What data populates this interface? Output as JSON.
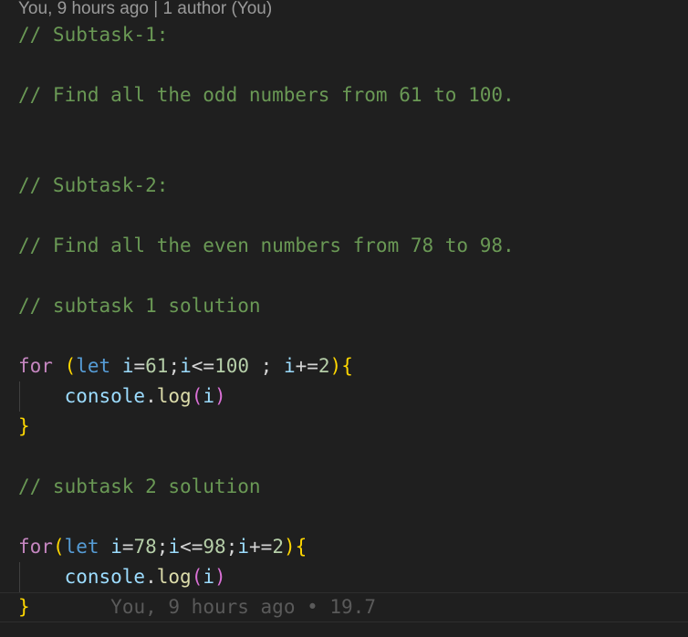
{
  "codelens": {
    "text": "You, 9 hours ago | 1 author (You)"
  },
  "comments": {
    "subtask1": "// Subtask-1:",
    "subtask1_desc": "// Find all the odd numbers from 61 to 100.",
    "subtask2": "// Subtask-2:",
    "subtask2_desc": "// Find all the even numbers from 78 to 98.",
    "solution1": "// subtask 1 solution",
    "solution2": "// subtask 2 solution"
  },
  "loop1": {
    "keyword": "for",
    "space": " ",
    "open_paren": "(",
    "let": "let",
    "var": "i",
    "assign": "=",
    "start": "61",
    "semi1": ";",
    "var2": "i",
    "cmp": "<=",
    "end": "100",
    "semi2": " ; ",
    "var3": "i",
    "inc_op": "+=",
    "step": "2",
    "close_paren": ")",
    "open_brace": "{",
    "close_brace": "}"
  },
  "loop2": {
    "keyword": "for",
    "open_paren": "(",
    "let": "let",
    "var": "i",
    "assign": "=",
    "start": "78",
    "semi1": ";",
    "var2": "i",
    "cmp": "<=",
    "end": "98",
    "semi2": ";",
    "var3": "i",
    "inc_op": "+=",
    "step": "2",
    "close_paren": ")",
    "open_brace": "{",
    "close_brace": "}"
  },
  "console_call": {
    "obj": "console",
    "dot": ".",
    "method": "log",
    "open": "(",
    "arg": "i",
    "close": ")"
  },
  "blame": {
    "text": "You, 9 hours ago • 19.7"
  },
  "colors": {
    "background": "#1f1f1f",
    "comment": "#6a9955",
    "keyword": "#c586c0",
    "storage": "#569cd6",
    "variable": "#9cdcfe",
    "number": "#b5cea8",
    "function": "#dcdcaa",
    "bracket_level1": "#ffd700",
    "bracket_level2": "#da70d6"
  }
}
